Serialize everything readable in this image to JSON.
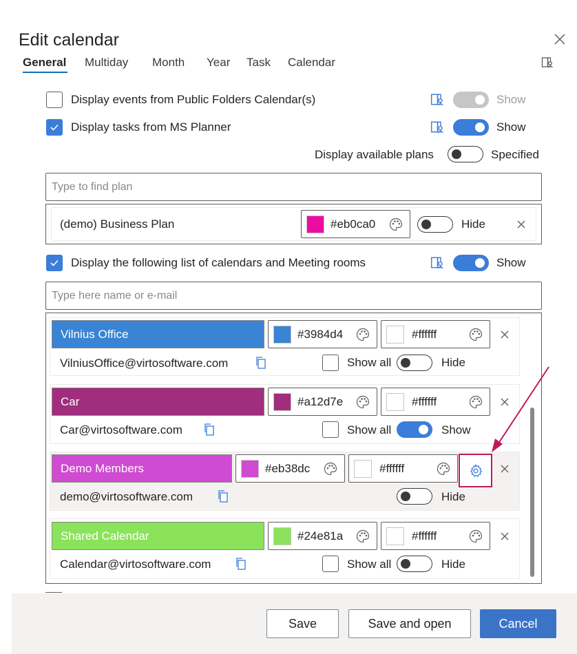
{
  "dialog": {
    "title": "Edit calendar"
  },
  "tabs": [
    {
      "label": "General"
    },
    {
      "label": "Multiday"
    },
    {
      "label": "Month"
    },
    {
      "label": "Year"
    },
    {
      "label": "Task"
    },
    {
      "label": "Calendar"
    }
  ],
  "public_folders": {
    "label": "Display events from Public Folders Calendar(s)",
    "checked": false,
    "toggle_label": "Show"
  },
  "planner": {
    "label": "Display tasks from MS Planner",
    "checked": true,
    "toggle_label": "Show"
  },
  "plans_option": {
    "label": "Display available plans",
    "toggle_label": "Specified"
  },
  "plan_search": {
    "placeholder": "Type to find plan"
  },
  "plans": [
    {
      "name": "(demo) Business Plan",
      "color": "#eb0ca0",
      "hex": "#eb0ca0",
      "toggle_label": "Hide"
    }
  ],
  "calendars_option": {
    "label": "Display the following list of calendars and Meeting rooms",
    "checked": true,
    "toggle_label": "Show"
  },
  "calendar_search": {
    "placeholder": "Type here name or e-mail"
  },
  "calendars": [
    {
      "name": "Vilnius Office",
      "email": "VilniusOffice@virtosoftware.com",
      "bg_hex": "#3984d4",
      "fg_hex": "#ffffff",
      "show_all_label": "Show all",
      "toggle_label": "Hide"
    },
    {
      "name": "Car",
      "email": "Car@virtosoftware.com",
      "bg_hex": "#a12d7e",
      "fg_hex": "#ffffff",
      "show_all_label": "Show all",
      "toggle_label": "Show"
    },
    {
      "name": "Demo Members",
      "email": "demo@virtosoftware.com",
      "bg_hex": "#eb38dc",
      "fg_hex": "#ffffff",
      "toggle_label": "Hide"
    },
    {
      "name": "Shared Calendar",
      "email": "Calendar@virtosoftware.com",
      "bg_hex": "#24e81a",
      "fg_hex": "#ffffff",
      "show_all_label": "Show all",
      "toggle_label": "Hide"
    }
  ],
  "footer": {
    "save": "Save",
    "save_open": "Save and open",
    "cancel": "Cancel"
  },
  "icons": {
    "close": "close-icon",
    "help": "book-person-icon",
    "palette": "palette-icon",
    "copy": "copy-icon",
    "remove": "remove-icon",
    "settings": "gear-icon",
    "check": "check-icon"
  },
  "colors": {
    "accent": "#3b7dd8",
    "annotation": "#c2185b"
  }
}
